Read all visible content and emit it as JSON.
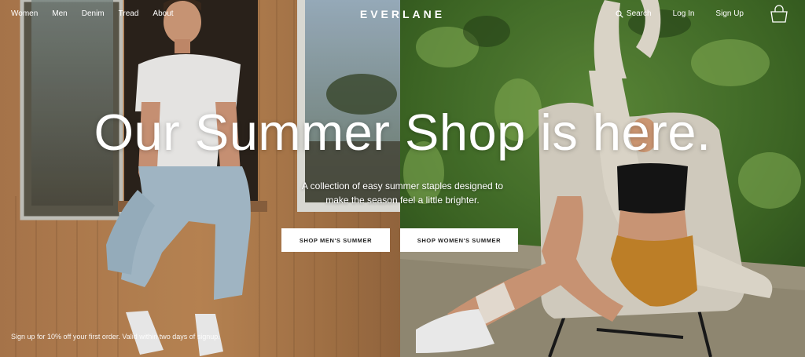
{
  "nav": {
    "links": [
      "Women",
      "Men",
      "Denim",
      "Tread",
      "About"
    ],
    "brand": "EVERLANE",
    "search_label": "Search",
    "login_label": "Log In",
    "signup_label": "Sign Up",
    "icons": [
      "search-icon",
      "shopping-bag-icon"
    ]
  },
  "hero": {
    "headline": "Our Summer Shop is here.",
    "subtitle_line1": "A collection of easy summer staples designed to",
    "subtitle_line2": "make the season feel a little brighter.",
    "cta_men": "SHOP MEN'S SUMMER",
    "cta_women": "SHOP WOMEN'S SUMMER"
  },
  "promo": {
    "text": "Sign up for 10% off your first order. Valid within two days of signup."
  },
  "colors": {
    "wood": "#a4734a",
    "foliage": "#3c6a27",
    "button_bg": "#ffffff",
    "button_text": "#222222"
  }
}
